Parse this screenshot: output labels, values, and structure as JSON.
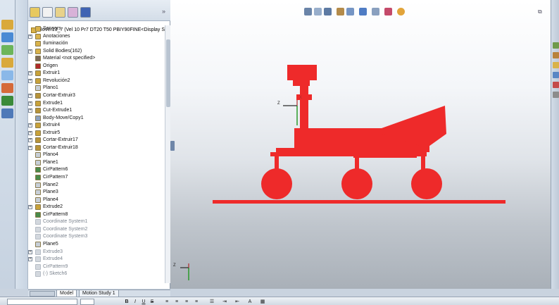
{
  "feature_tree": {
    "root_label": "Rover13_7  (Vel 10  Pr7  DT20 T50  PBIY90FINE<Display State-",
    "items": [
      {
        "label": "Sensors",
        "expander": "",
        "icon": "sensor-folder-icon",
        "dim": false
      },
      {
        "label": "Anotaciones",
        "expander": "+",
        "icon": "annotations-icon",
        "dim": false
      },
      {
        "label": "Iluminación",
        "expander": "",
        "icon": "lighting-folder-icon",
        "dim": false
      },
      {
        "label": "Solid Bodies(162)",
        "expander": "+",
        "icon": "solid-bodies-icon",
        "dim": false
      },
      {
        "label": "Material <not specified>",
        "expander": "",
        "icon": "material-icon",
        "dim": false
      },
      {
        "label": "Origen",
        "expander": "",
        "icon": "origin-icon",
        "dim": false
      },
      {
        "label": "Extruir1",
        "expander": "+",
        "icon": "extrude-icon",
        "dim": false
      },
      {
        "label": "Revolución2",
        "expander": "+",
        "icon": "revolve-icon",
        "dim": false
      },
      {
        "label": "Plano1",
        "expander": "",
        "icon": "plane-icon",
        "dim": false
      },
      {
        "label": "Cortar-Extruir3",
        "expander": "+",
        "icon": "cut-extrude-icon",
        "dim": false
      },
      {
        "label": "Extrude1",
        "expander": "+",
        "icon": "extrude-icon",
        "dim": false
      },
      {
        "label": "Cut-Extrude1",
        "expander": "+",
        "icon": "cut-extrude-icon",
        "dim": false
      },
      {
        "label": "Body-Move/Copy1",
        "expander": "",
        "icon": "body-move-icon",
        "dim": false
      },
      {
        "label": "Extruir4",
        "expander": "+",
        "icon": "extrude-icon",
        "dim": false
      },
      {
        "label": "Extruir5",
        "expander": "+",
        "icon": "extrude-icon",
        "dim": false
      },
      {
        "label": "Cortar-Extruir17",
        "expander": "+",
        "icon": "cut-extrude-icon",
        "dim": false
      },
      {
        "label": "Cortar-Extruir18",
        "expander": "+",
        "icon": "cut-extrude-icon",
        "dim": false
      },
      {
        "label": "Plano4",
        "expander": "",
        "icon": "plane-icon",
        "dim": false
      },
      {
        "label": "Plane1",
        "expander": "",
        "icon": "plane-icon",
        "dim": false
      },
      {
        "label": "CirPattern6",
        "expander": "",
        "icon": "circular-pattern-icon",
        "dim": false
      },
      {
        "label": "CirPattern7",
        "expander": "",
        "icon": "circular-pattern-icon",
        "dim": false
      },
      {
        "label": "Plane2",
        "expander": "",
        "icon": "plane-icon",
        "dim": false
      },
      {
        "label": "Plane3",
        "expander": "",
        "icon": "plane-icon",
        "dim": false
      },
      {
        "label": "Plane4",
        "expander": "",
        "icon": "plane-icon",
        "dim": false
      },
      {
        "label": "Extrude2",
        "expander": "+",
        "icon": "extrude-icon",
        "dim": false
      },
      {
        "label": "CirPattern8",
        "expander": "",
        "icon": "circular-pattern-icon",
        "dim": false
      },
      {
        "label": "Coordinate System1",
        "expander": "",
        "icon": "coordinate-system-icon",
        "dim": true
      },
      {
        "label": "Coordinate System2",
        "expander": "",
        "icon": "coordinate-system-icon",
        "dim": true
      },
      {
        "label": "Coordinate System3",
        "expander": "",
        "icon": "coordinate-system-icon",
        "dim": true
      },
      {
        "label": "Plane5",
        "expander": "",
        "icon": "plane-icon",
        "dim": false
      },
      {
        "label": "Extrude3",
        "expander": "+",
        "icon": "extrude-icon",
        "dim": true
      },
      {
        "label": "Extrude4",
        "expander": "+",
        "icon": "extrude-icon",
        "dim": true
      },
      {
        "label": "CirPattern9",
        "expander": "",
        "icon": "circular-pattern-icon",
        "dim": true
      },
      {
        "label": "(-) Sketch6",
        "expander": "",
        "icon": "sketch-icon",
        "dim": true
      }
    ]
  },
  "bottom_tabs": {
    "model": "Model",
    "motion_study": "Motion Study 1"
  },
  "viewport": {
    "triad_top": {
      "x_label": "Z",
      "y_label": "X"
    },
    "triad_bottom": {
      "x_label": "Z"
    }
  },
  "format_bar": {
    "bold": "B",
    "italic": "I",
    "underline": "U",
    "strike": "S"
  },
  "colors": {
    "model": "#ee2a2a",
    "feature_icon": "#c9a23a",
    "panel_bg": "#ffffff",
    "accent": "#2d6bc4"
  }
}
